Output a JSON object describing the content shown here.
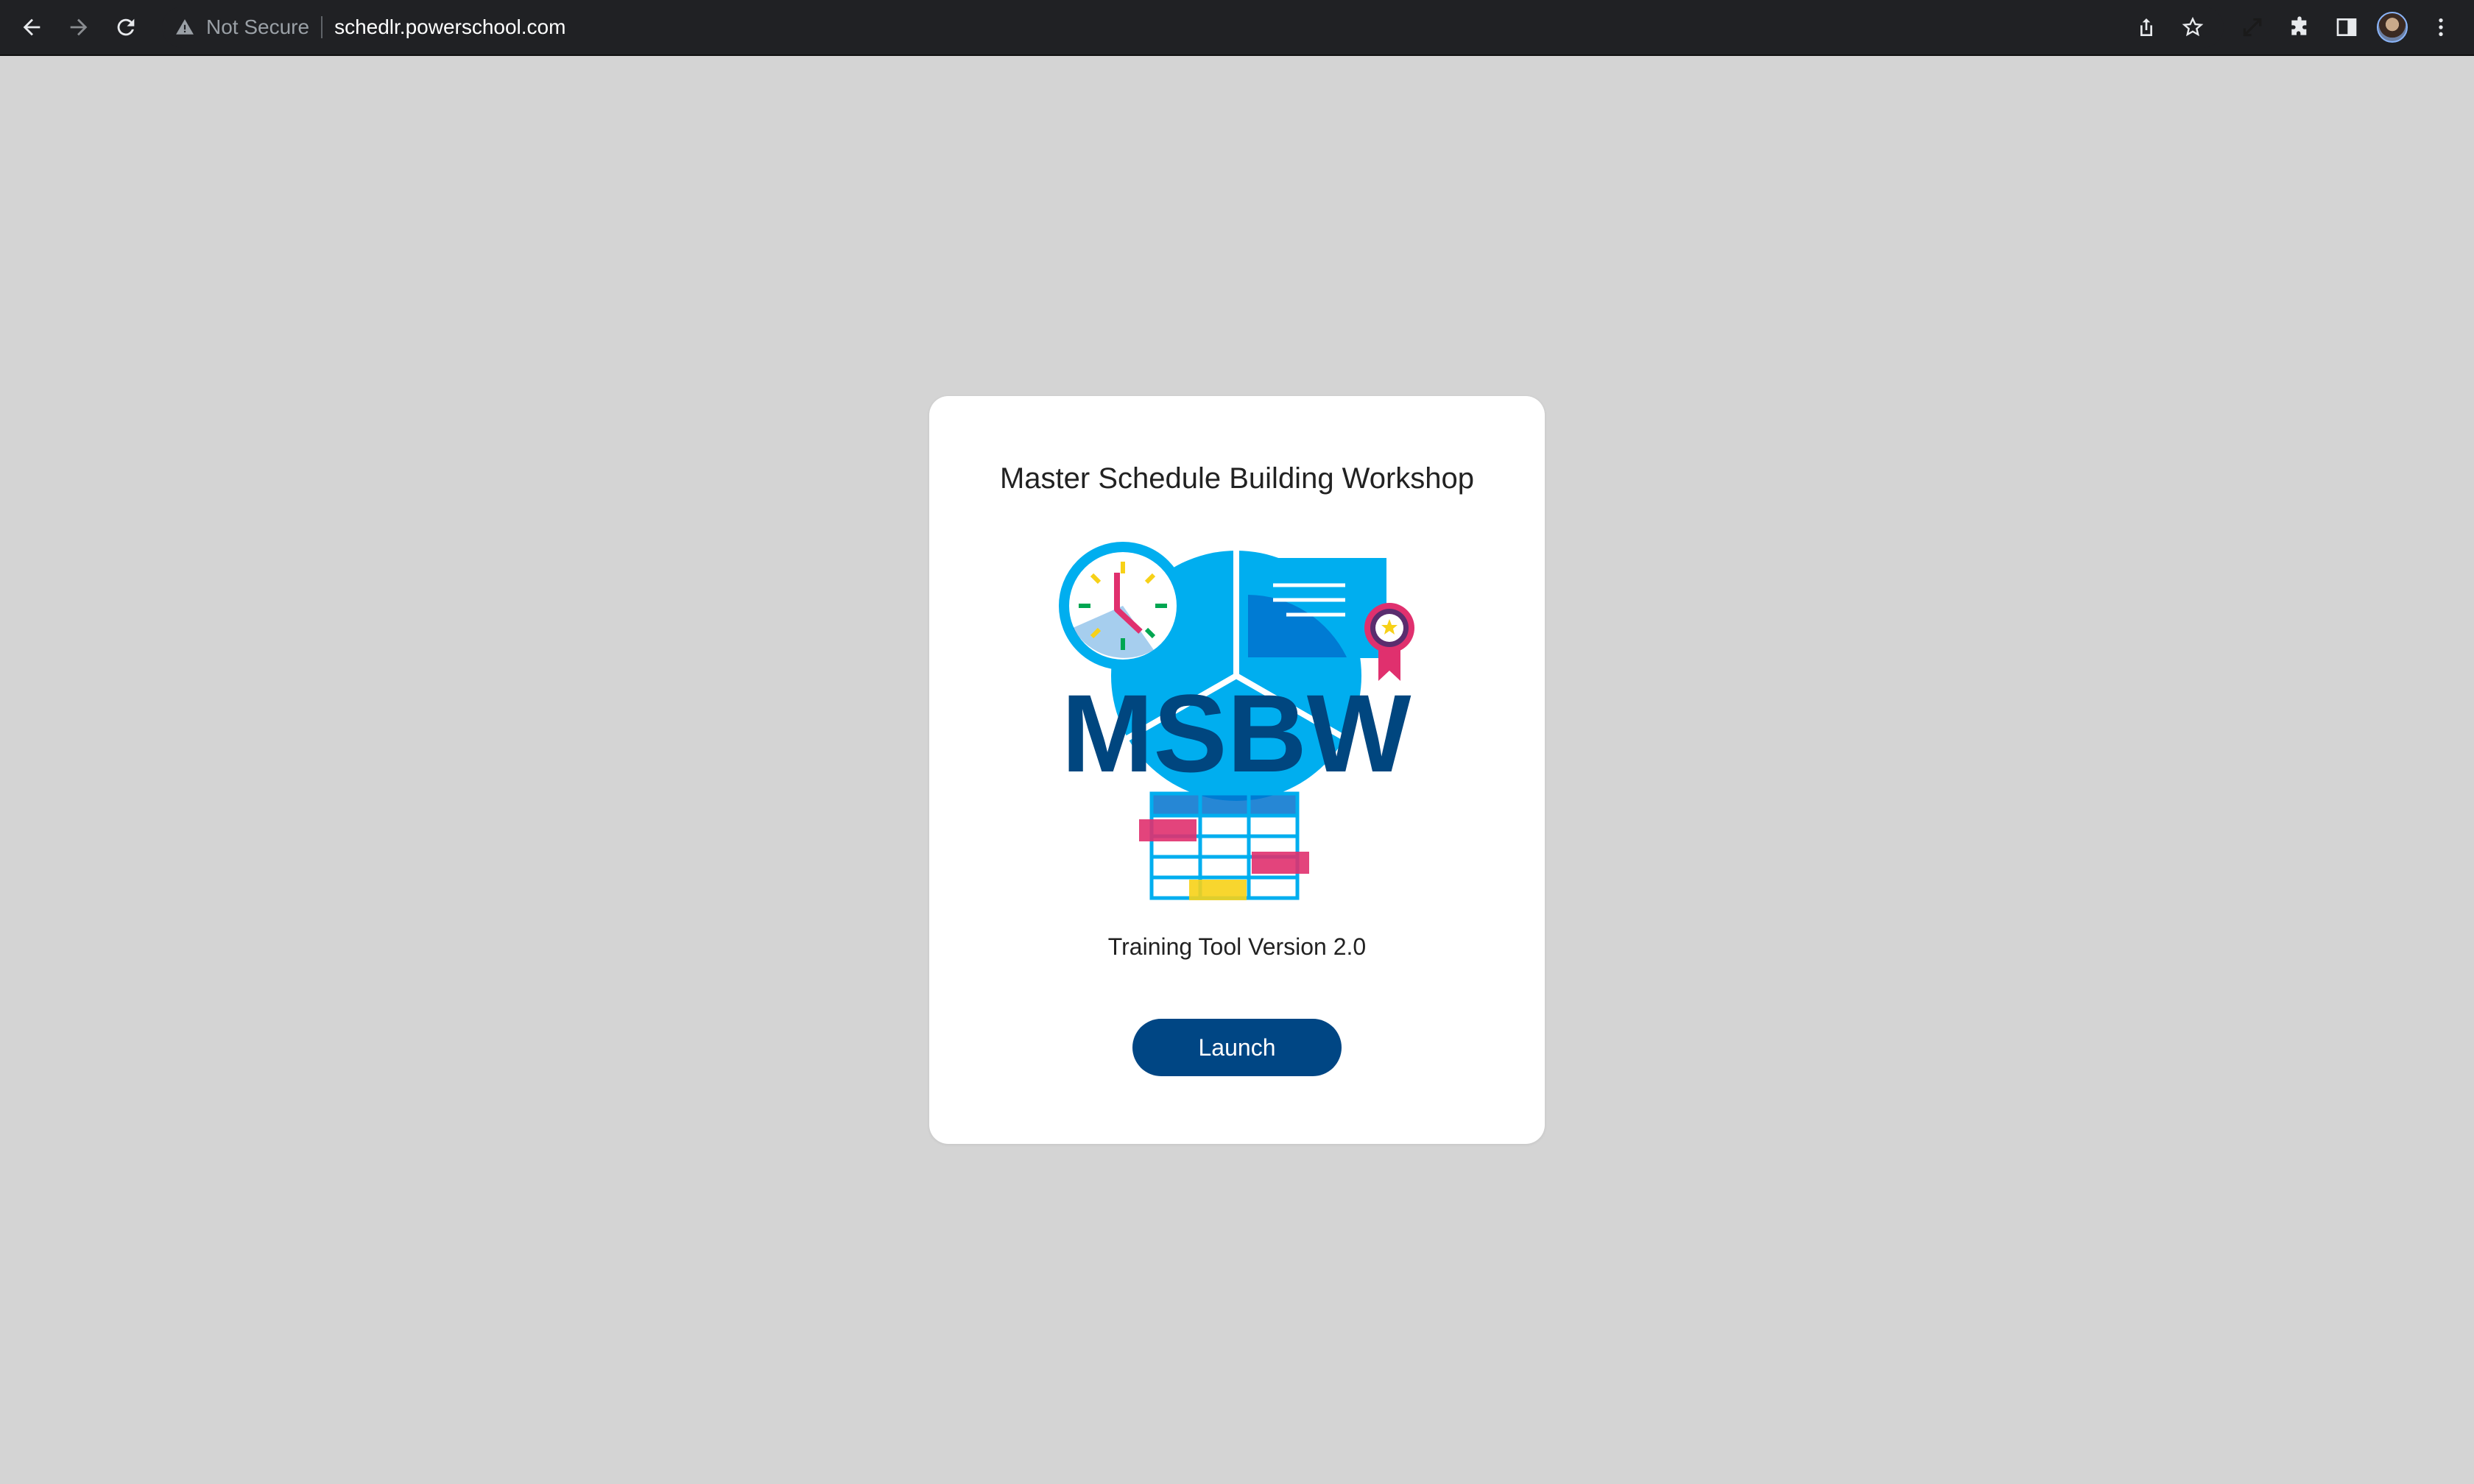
{
  "browser": {
    "security_label": "Not Secure",
    "url": "schedlr.powerschool.com",
    "icons": {
      "back": "back-arrow-icon",
      "forward": "forward-arrow-icon",
      "reload": "reload-icon",
      "warning": "warning-icon",
      "share": "share-icon",
      "bookmark": "star-icon",
      "fullscreen": "expand-icon",
      "extensions": "puzzle-icon",
      "sidepanel": "side-panel-icon",
      "profile": "avatar",
      "menu": "kebab-menu-icon"
    }
  },
  "card": {
    "title": "Master Schedule Building Workshop",
    "logo_text": "MSBW",
    "version": "Training Tool Version 2.0",
    "launch_label": "Launch"
  },
  "colors": {
    "page_background": "#d4d4d4",
    "toolbar": "#202124",
    "card": "#ffffff",
    "launch_button": "#004684",
    "logo_text": "#00467f",
    "logo_blue": "#00aeef",
    "logo_dark_blue": "#0072ce",
    "logo_pink": "#e0306e",
    "logo_yellow": "#f7d117",
    "logo_green": "#00a651"
  }
}
